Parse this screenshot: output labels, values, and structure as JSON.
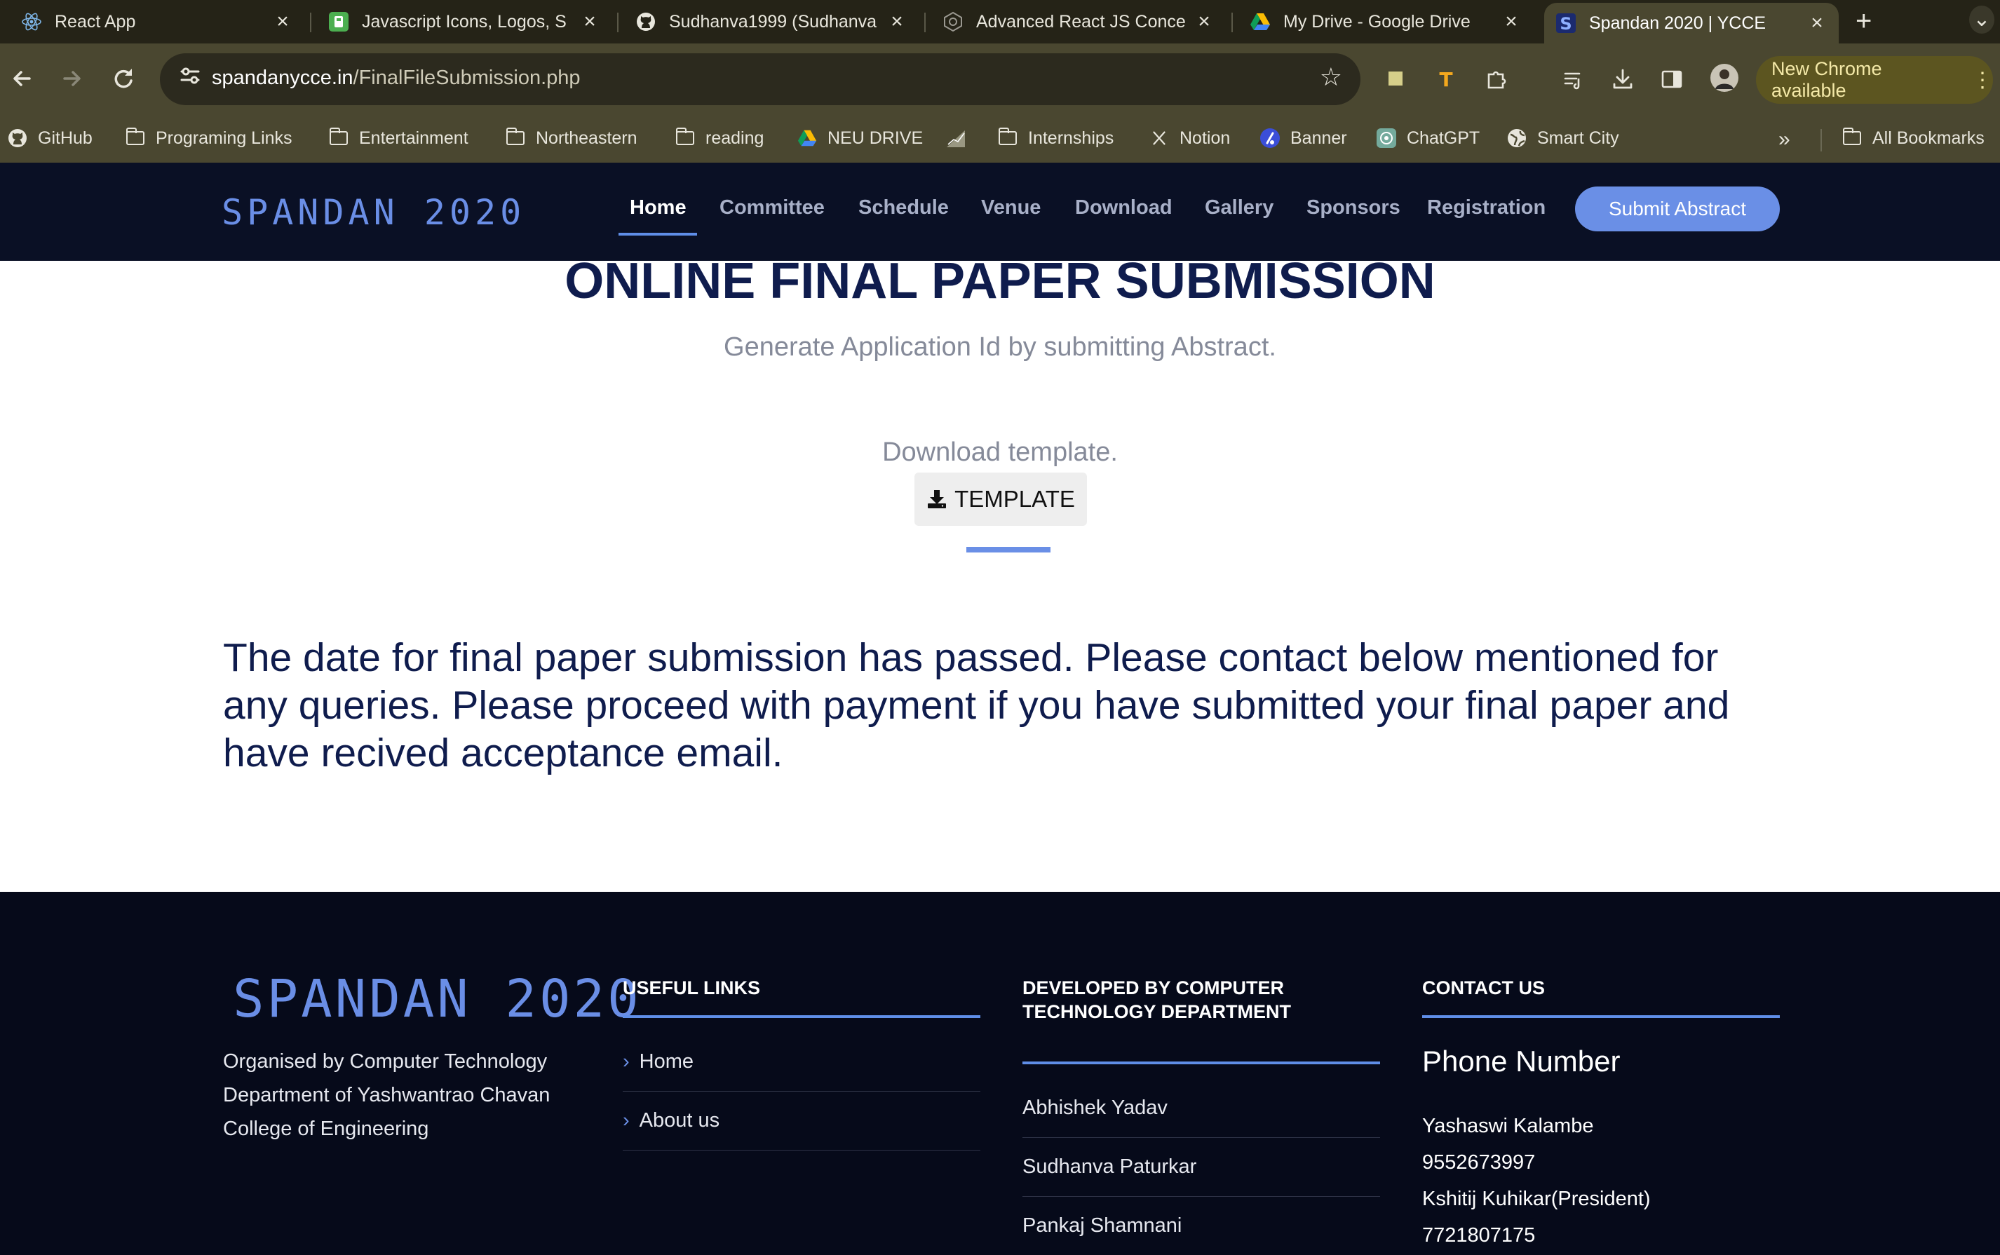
{
  "browser": {
    "tabs": [
      {
        "title": "React App",
        "icon": "react-icon"
      },
      {
        "title": "Javascript Icons, Logos, S",
        "icon": "iconscout-icon"
      },
      {
        "title": "Sudhanva1999 (Sudhanva",
        "icon": "github-icon"
      },
      {
        "title": "Advanced React JS Conce",
        "icon": "web-icon"
      },
      {
        "title": "My Drive - Google Drive",
        "icon": "google-drive-icon"
      },
      {
        "title": "Spandan 2020 | YCCE",
        "icon": "spandan-s-icon"
      }
    ],
    "url_host": "spandanycce.in",
    "url_path": "/FinalFileSubmission.php",
    "update_label": "New Chrome available",
    "bookmarks": [
      {
        "label": "GitHub",
        "icon": "github-icon"
      },
      {
        "label": "Programing Links",
        "icon": "folder-icon"
      },
      {
        "label": "Entertainment",
        "icon": "folder-icon"
      },
      {
        "label": "Northeastern",
        "icon": "folder-icon"
      },
      {
        "label": "reading",
        "icon": "folder-icon"
      },
      {
        "label": "NEU DRIVE",
        "icon": "google-drive-icon"
      },
      {
        "label": "Internships",
        "icon": "folder-icon"
      },
      {
        "label": "Notion",
        "icon": "notion-icon"
      },
      {
        "label": "Banner",
        "icon": "banner-icon"
      },
      {
        "label": "ChatGPT",
        "icon": "chatgpt-icon"
      },
      {
        "label": "Smart City",
        "icon": "globe-icon"
      }
    ],
    "all_bookmarks_label": "All Bookmarks"
  },
  "site": {
    "logo": "SPANDAN 2020",
    "nav": [
      "Home",
      "Committee",
      "Schedule",
      "Venue",
      "Download",
      "Gallery",
      "Sponsors",
      "Registration"
    ],
    "submit_label": "Submit Abstract",
    "accent_color": "#6a8fe6",
    "header_bg": "#0a1025"
  },
  "main": {
    "title": "ONLINE FINAL PAPER SUBMISSION",
    "subtitle": "Generate Application Id by submitting Abstract.",
    "download_text": "Download template.",
    "template_label": "TEMPLATE",
    "notice": "The date for final paper submission has passed. Please contact below mentioned for any queries. Please proceed with payment if you have submitted your final paper and have recived acceptance email."
  },
  "footer": {
    "logo": "SPANDAN 2020",
    "org_text": "Organised by Computer Technology Department of Yashwantrao Chavan College of Engineering",
    "useful_links_title": "USEFUL LINKS",
    "useful_links": [
      "Home",
      "About us"
    ],
    "developed_by_title": "DEVELOPED BY COMPUTER TECHNOLOGY DEPARTMENT",
    "developers": [
      "Abhishek Yadav",
      "Sudhanva Paturkar",
      "Pankaj Shamnani"
    ],
    "contact_title": "CONTACT US",
    "phone_title": "Phone Number",
    "contacts": [
      {
        "name": "Yashaswi Kalambe",
        "phone": "9552673997"
      },
      {
        "name": "Kshitij Kuhikar(President)",
        "phone": "7721807175"
      }
    ]
  }
}
